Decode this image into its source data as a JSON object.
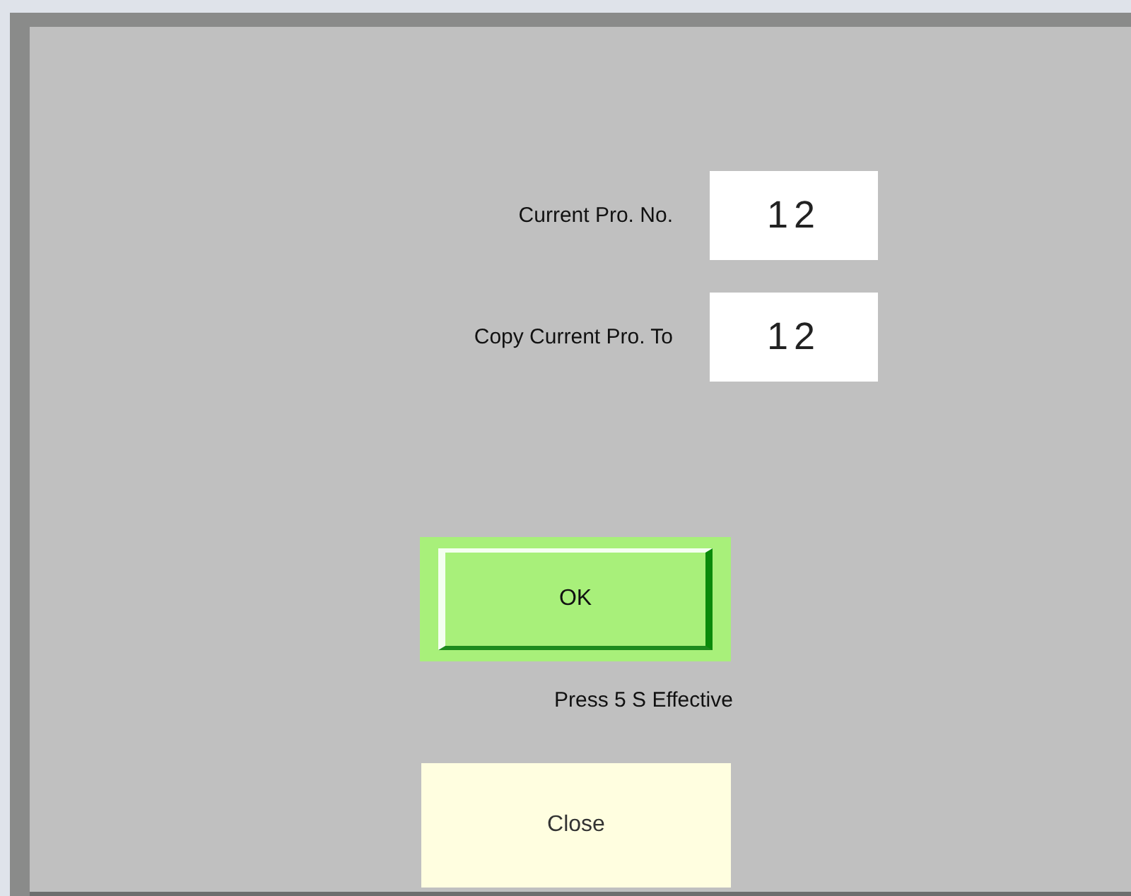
{
  "fields": [
    {
      "label": "Current Pro. No.",
      "value": "12"
    },
    {
      "label": "Copy Current Pro. To",
      "value": "12"
    }
  ],
  "ok_button": {
    "label": "OK"
  },
  "hint": "Press 5 S Effective",
  "close_button": {
    "label": "Close"
  }
}
